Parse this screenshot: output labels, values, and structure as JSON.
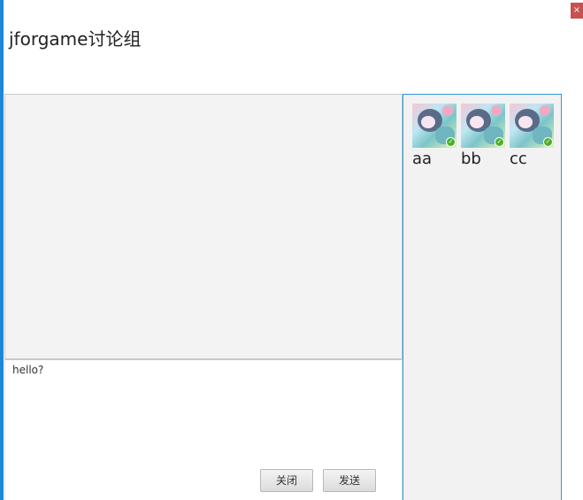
{
  "window": {
    "title": "jforgame讨论组",
    "close_label": "×"
  },
  "chat": {
    "input_value": "hello?"
  },
  "buttons": {
    "close_label": "关闭",
    "send_label": "发送"
  },
  "members": [
    {
      "name": "aa",
      "online": true
    },
    {
      "name": "bb",
      "online": true
    },
    {
      "name": "cc",
      "online": true
    }
  ],
  "colors": {
    "accent": "#1e88d8",
    "close_button": "#c75050",
    "online_status": "#4caf2a"
  }
}
